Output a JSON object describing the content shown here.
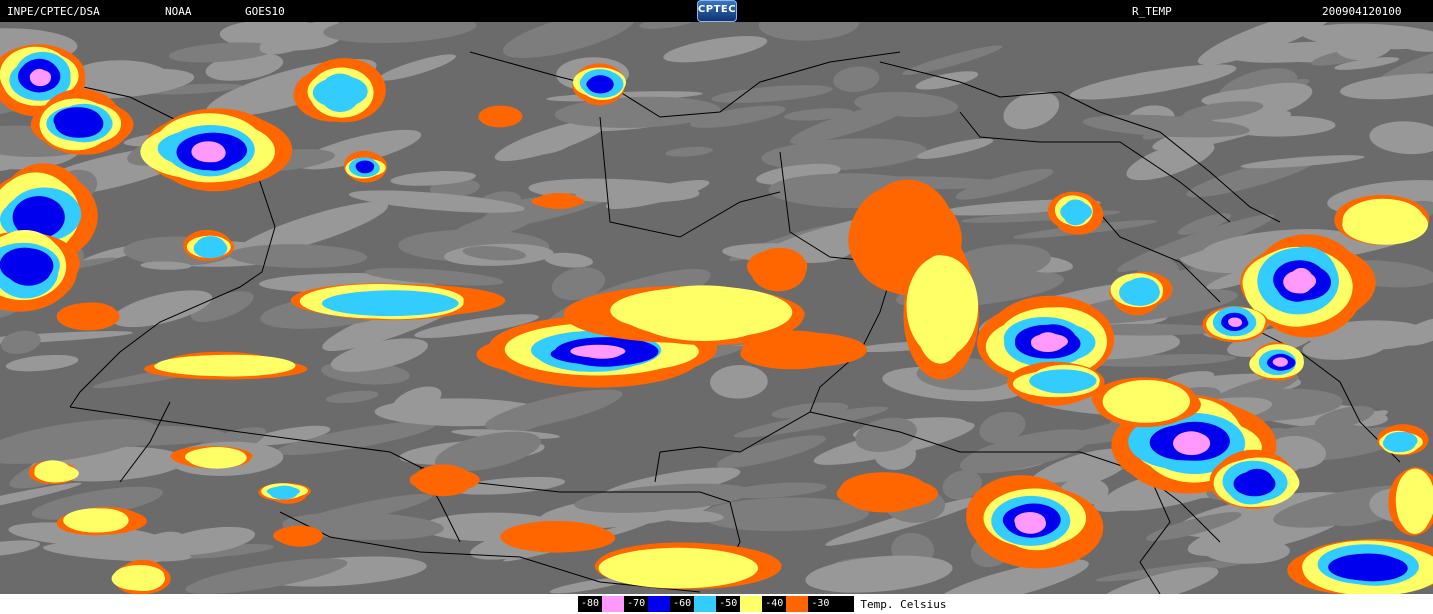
{
  "header": {
    "institution": "INPE/CPTEC/DSA",
    "agency": "NOAA",
    "satellite": "GOES10",
    "logo_text": "CPTEC",
    "product": "R_TEMP",
    "timestamp": "200904120100"
  },
  "legend": {
    "items": [
      {
        "label": "-80",
        "color": "#ff99ff"
      },
      {
        "label": "-70",
        "color": "#0000ee"
      },
      {
        "label": "-60",
        "color": "#33ccff"
      },
      {
        "label": "-50",
        "color": "#ffff66"
      },
      {
        "label": "-40",
        "color": "#ff6600"
      },
      {
        "label": "-30",
        "color": "#000000"
      }
    ],
    "unit_label": "Temp. Celsius"
  },
  "colors": {
    "pink": "#ff99ff",
    "blue": "#0000ee",
    "cyan": "#33ccff",
    "yellow": "#ffff66",
    "orange": "#ff6600",
    "background_gray": "#6b6b6b",
    "cloud_gray": "#bdbdbd"
  }
}
